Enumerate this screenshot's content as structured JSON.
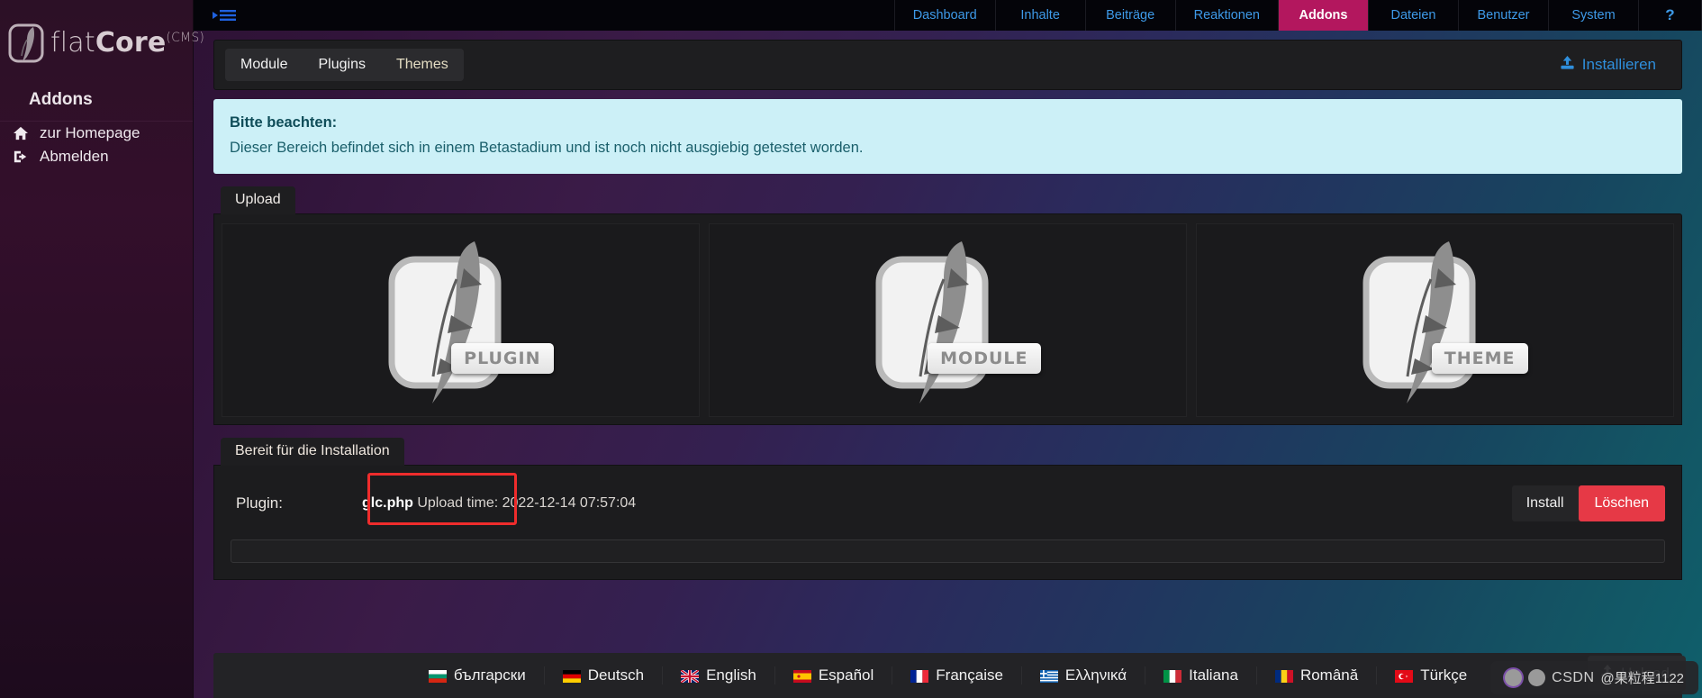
{
  "brand": {
    "name_light": "flat",
    "name_bold": "Core",
    "suffix": "(CMS)",
    "logo_icon": "feather-logo-icon"
  },
  "sidebar": {
    "section_title": "Addons",
    "links": [
      {
        "icon": "home-icon",
        "label": "zur Homepage"
      },
      {
        "icon": "logout-icon",
        "label": "Abmelden"
      }
    ]
  },
  "topbar": {
    "menu_toggle_icon": "collapse-menu-icon",
    "nav": [
      {
        "label": "Dashboard",
        "active": false
      },
      {
        "label": "Inhalte",
        "active": false
      },
      {
        "label": "Beiträge",
        "active": false
      },
      {
        "label": "Reaktionen",
        "active": false
      },
      {
        "label": "Addons",
        "active": true
      },
      {
        "label": "Dateien",
        "active": false
      },
      {
        "label": "Benutzer",
        "active": false
      },
      {
        "label": "System",
        "active": false
      },
      {
        "label": "?",
        "active": false
      }
    ],
    "active_color": "#b3175e",
    "link_color": "#3e9ae8"
  },
  "toolbar": {
    "tabs": [
      {
        "label": "Module"
      },
      {
        "label": "Plugins"
      },
      {
        "label": "Themes"
      }
    ],
    "install_label": "Installieren",
    "install_icon": "upload-icon"
  },
  "notice": {
    "title": "Bitte beachten:",
    "body": "Dieser Bereich befindet sich in einem Betastadium und ist noch nicht ausgiebig getestet worden.",
    "bg": "#ccf0f7"
  },
  "upload_section": {
    "tab_label": "Upload",
    "slots": [
      {
        "badge": "PLUGIN"
      },
      {
        "badge": "MODULE"
      },
      {
        "badge": "THEME"
      }
    ]
  },
  "ready_section": {
    "tab_label": "Bereit für die Installation",
    "row": {
      "type_label": "Plugin:",
      "file_name": "glc.php",
      "time_label": "Upload time:",
      "time_value": "2022-12-14 07:57:04",
      "install_label": "Install",
      "delete_label": "Löschen",
      "delete_color": "#e63946",
      "highlight_color": "#ef2c2c"
    },
    "empty_field_value": ""
  },
  "footer": {
    "languages": [
      {
        "label": "български",
        "flag": "bg"
      },
      {
        "label": "Deutsch",
        "flag": "de"
      },
      {
        "label": "English",
        "flag": "gb"
      },
      {
        "label": "Español",
        "flag": "es"
      },
      {
        "label": "Française",
        "flag": "fr"
      },
      {
        "label": "Ελληνικά",
        "flag": "gr"
      },
      {
        "label": "Italiana",
        "flag": "it"
      },
      {
        "label": "Română",
        "flag": "ro"
      },
      {
        "label": "Türkçe",
        "flag": "tr"
      }
    ]
  },
  "upload_fab": {
    "label": "Upload",
    "icon": "upload-icon"
  },
  "watermark": {
    "brand": "CSDN",
    "user": "@果粒程1122"
  }
}
